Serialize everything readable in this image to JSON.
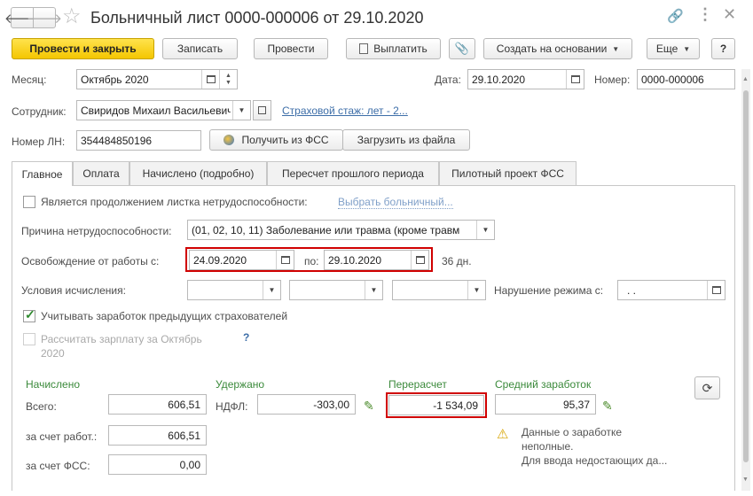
{
  "window": {
    "title": "Больничный лист 0000-000006 от 29.10.2020"
  },
  "toolbar": {
    "post_close": "Провести и закрыть",
    "save": "Записать",
    "post": "Провести",
    "pay": "Выплатить",
    "create_based": "Создать на основании",
    "more": "Еще",
    "help": "?"
  },
  "header": {
    "month_label": "Месяц:",
    "month_value": "Октябрь 2020",
    "date_label": "Дата:",
    "date_value": "29.10.2020",
    "number_label": "Номер:",
    "number_value": "0000-000006",
    "employee_label": "Сотрудник:",
    "employee_value": "Свиридов Михаил Васильевич",
    "insurance_link": "Страховой стаж: лет - 2...",
    "ln_label": "Номер ЛН:",
    "ln_value": "354484850196",
    "get_fss": "Получить из ФСС",
    "load_file": "Загрузить из файла"
  },
  "tabs": [
    {
      "label": "Главное"
    },
    {
      "label": "Оплата"
    },
    {
      "label": "Начислено (подробно)"
    },
    {
      "label": "Пересчет прошлого периода"
    },
    {
      "label": "Пилотный проект ФСС"
    }
  ],
  "main": {
    "continuation_label": "Является продолжением листка нетрудоспособности:",
    "continuation_checked": false,
    "choose_sick_link": "Выбрать больничный...",
    "reason_label": "Причина нетрудоспособности:",
    "reason_value": "(01, 02, 10, 11) Заболевание или травма (кроме травм",
    "release_label": "Освобождение от работы с:",
    "release_from": "24.09.2020",
    "release_to_label": "по:",
    "release_to": "29.10.2020",
    "days": "36 дн.",
    "conditions_label": "Условия исчисления:",
    "violation_label": "Нарушение режима с:",
    "violation_value": " .  .",
    "prev_insurers_label": "Учитывать заработок предыдущих страхователей",
    "prev_insurers_checked": true,
    "calc_salary_label_1": "Рассчитать зарплату за Октябрь",
    "calc_salary_label_2": "2020",
    "calc_salary_checked": false,
    "help_mark": "?"
  },
  "totals": {
    "accrued_header": "Начислено",
    "withheld_header": "Удержано",
    "recalc_header": "Перерасчет",
    "avg_header": "Средний заработок",
    "total_label": "Всего:",
    "total_value": "606,51",
    "employer_label": "за счет работ.:",
    "employer_value": "606,51",
    "fss_label": "за счет ФСС:",
    "fss_value": "0,00",
    "ndfl_label": "НДФЛ:",
    "ndfl_value": "-303,00",
    "recalc_value": "-1 534,09",
    "avg_value": "95,37",
    "warning_1": "Данные о заработке",
    "warning_2": "неполные.",
    "warning_3": "Для ввода недостающих да..."
  }
}
